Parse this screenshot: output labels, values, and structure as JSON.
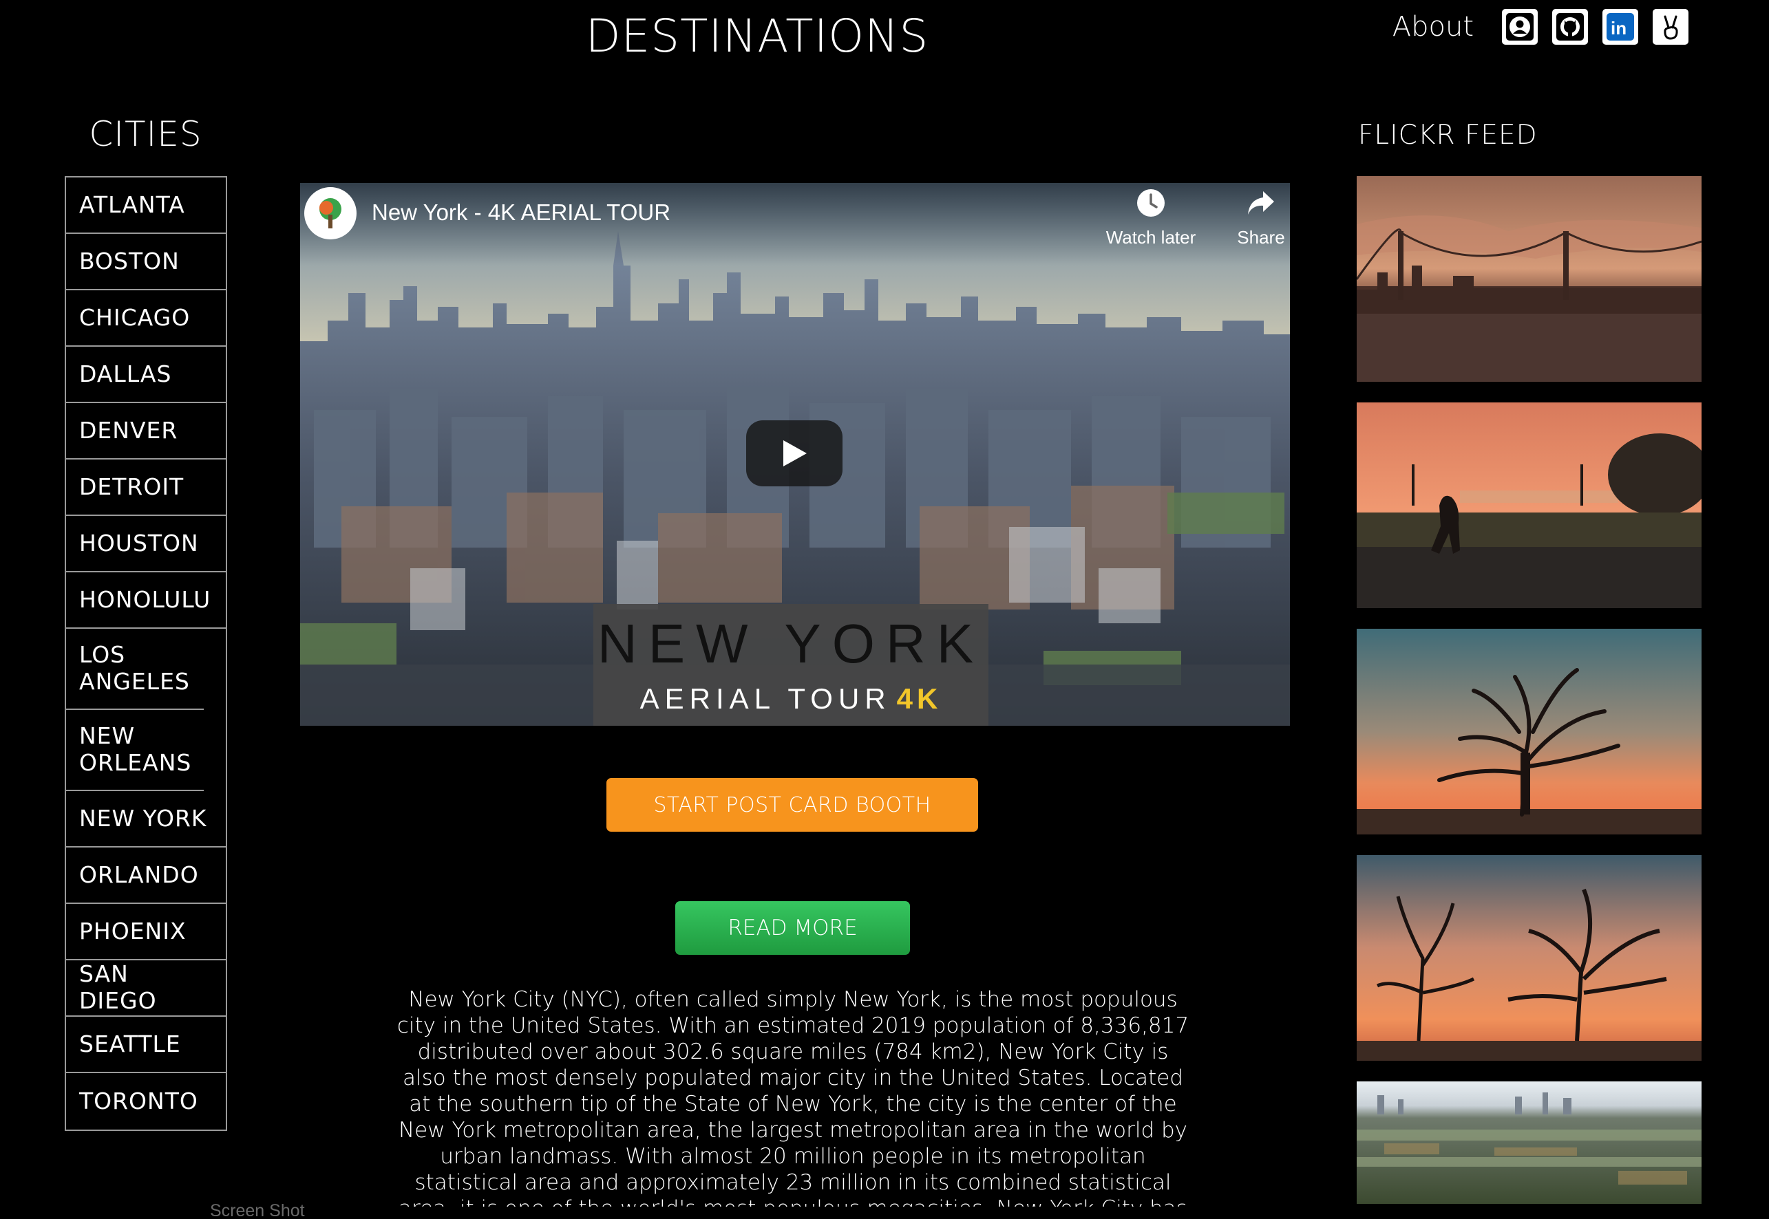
{
  "header": {
    "title": "DESTINATIONS",
    "about_label": "About",
    "social_icons": [
      "profile-icon",
      "github-icon",
      "linkedin-icon",
      "angellist-icon"
    ]
  },
  "sidebar": {
    "heading": "CITIES",
    "cities": [
      "ATLANTA",
      "BOSTON",
      "CHICAGO",
      "DALLAS",
      "DENVER",
      "DETROIT",
      "HOUSTON",
      "HONOLULU",
      "LOS ANGELES",
      "NEW ORLEANS",
      "NEW YORK",
      "ORLANDO",
      "PHOENIX",
      "SAN DIEGO",
      "SEATTLE",
      "TORONTO"
    ]
  },
  "video": {
    "title": "New York - 4K AERIAL TOUR",
    "watch_later_label": "Watch later",
    "share_label": "Share",
    "overlay_line1": "NEW YORK",
    "overlay_line2": "AERIAL TOUR",
    "overlay_accent": "4K"
  },
  "buttons": {
    "postcard_booth": "START POST CARD BOOTH",
    "read_more": "READ MORE"
  },
  "description": "New York City (NYC), often called simply New York, is the most populous city in the United States. With an estimated 2019 population of 8,336,817 distributed over about 302.6 square miles (784 km2), New York City is also the most densely populated major city in the United States. Located at the southern tip of the State of New York, the city is the center of the New York metropolitan area, the largest metropolitan area in the world by urban landmass. With almost 20 million people in its metropolitan statistical area and approximately 23 million in its combined statistical area, it is one of the world's most populous megacities. New York City has",
  "flickr": {
    "heading": "FLICKR FEED"
  },
  "footer": {
    "screenshot_label": "Screen Shot"
  },
  "colors": {
    "background": "#000000",
    "booth_button": "#f7941d",
    "read_more_button": "#2eb351",
    "video_overlay_accent": "#f2c62a"
  }
}
